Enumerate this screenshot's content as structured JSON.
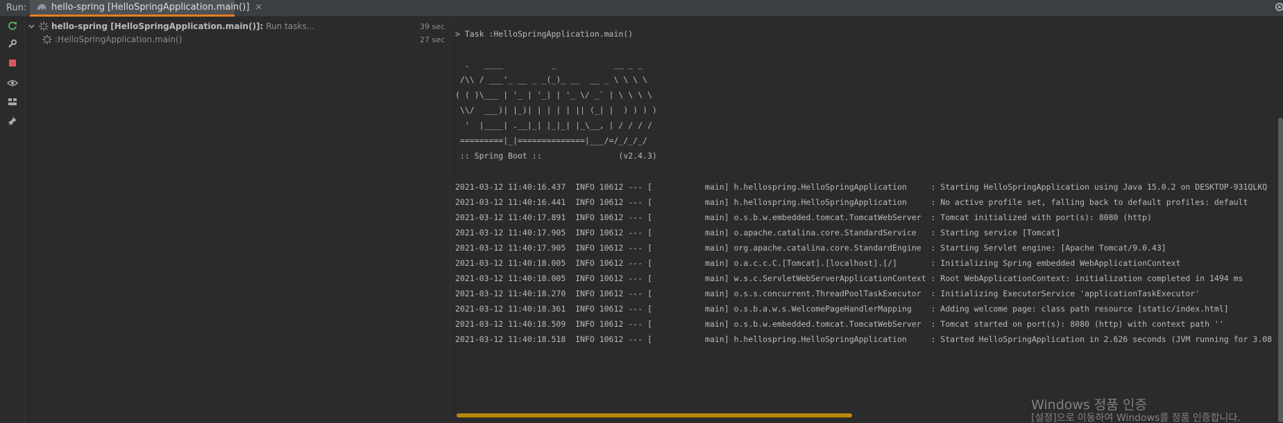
{
  "run_panel": {
    "run_label": "Run:",
    "tab_title": "hello-spring [HelloSpringApplication.main()]",
    "tab_close": "×"
  },
  "tree": {
    "root": {
      "name": "hello-spring [HelloSpringApplication.main()]:",
      "status": "Run tasks...",
      "duration": "39 sec"
    },
    "child": {
      "name": ":HelloSpringApplication.main()",
      "duration": "27 sec"
    }
  },
  "console": {
    "task_line": "> Task :HelloSpringApplication.main()",
    "banner": [
      "  .   ____          _            __ _ _",
      " /\\\\ / ___'_ __ _ _(_)_ __  __ _ \\ \\ \\ \\",
      "( ( )\\___ | '_ | '_| | '_ \\/ _` | \\ \\ \\ \\",
      " \\\\/  ___)| |_)| | | | | || (_| |  ) ) ) )",
      "  '  |____| .__|_| |_|_| |_\\__, | / / / /",
      " =========|_|==============|___/=/_/_/_/",
      " :: Spring Boot ::                (v2.4.3)"
    ],
    "log_lines": [
      "2021-03-12 11:40:16.437  INFO 10612 --- [           main] h.hellospring.HelloSpringApplication     : Starting HelloSpringApplication using Java 15.0.2 on DESKTOP-931QLKQ",
      "2021-03-12 11:40:16.441  INFO 10612 --- [           main] h.hellospring.HelloSpringApplication     : No active profile set, falling back to default profiles: default",
      "2021-03-12 11:40:17.891  INFO 10612 --- [           main] o.s.b.w.embedded.tomcat.TomcatWebServer  : Tomcat initialized with port(s): 8080 (http)",
      "2021-03-12 11:40:17.905  INFO 10612 --- [           main] o.apache.catalina.core.StandardService   : Starting service [Tomcat]",
      "2021-03-12 11:40:17.905  INFO 10612 --- [           main] org.apache.catalina.core.StandardEngine  : Starting Servlet engine: [Apache Tomcat/9.0.43]",
      "2021-03-12 11:40:18.005  INFO 10612 --- [           main] o.a.c.c.C.[Tomcat].[localhost].[/]       : Initializing Spring embedded WebApplicationContext",
      "2021-03-12 11:40:18.005  INFO 10612 --- [           main] w.s.c.ServletWebServerApplicationContext : Root WebApplicationContext: initialization completed in 1494 ms",
      "2021-03-12 11:40:18.270  INFO 10612 --- [           main] o.s.s.concurrent.ThreadPoolTaskExecutor  : Initializing ExecutorService 'applicationTaskExecutor'",
      "2021-03-12 11:40:18.361  INFO 10612 --- [           main] o.s.b.a.w.s.WelcomePageHandlerMapping    : Adding welcome page: class path resource [static/index.html]",
      "2021-03-12 11:40:18.509  INFO 10612 --- [           main] o.s.b.w.embedded.tomcat.TomcatWebServer  : Tomcat started on port(s): 8080 (http) with context path ''",
      "2021-03-12 11:40:18.518  INFO 10612 --- [           main] h.hellospring.HelloSpringApplication     : Started HelloSpringApplication in 2.626 seconds (JVM running for 3.08"
    ]
  },
  "watermark": {
    "line1": "Windows 정품 인증",
    "line2": "[설정]으로 이동하여 Windows를 정품 인증합니다."
  },
  "colors": {
    "accent": "#e67e22",
    "rerun": "#59a869",
    "stop": "#db5860",
    "scrollbar": "#b8860b"
  }
}
